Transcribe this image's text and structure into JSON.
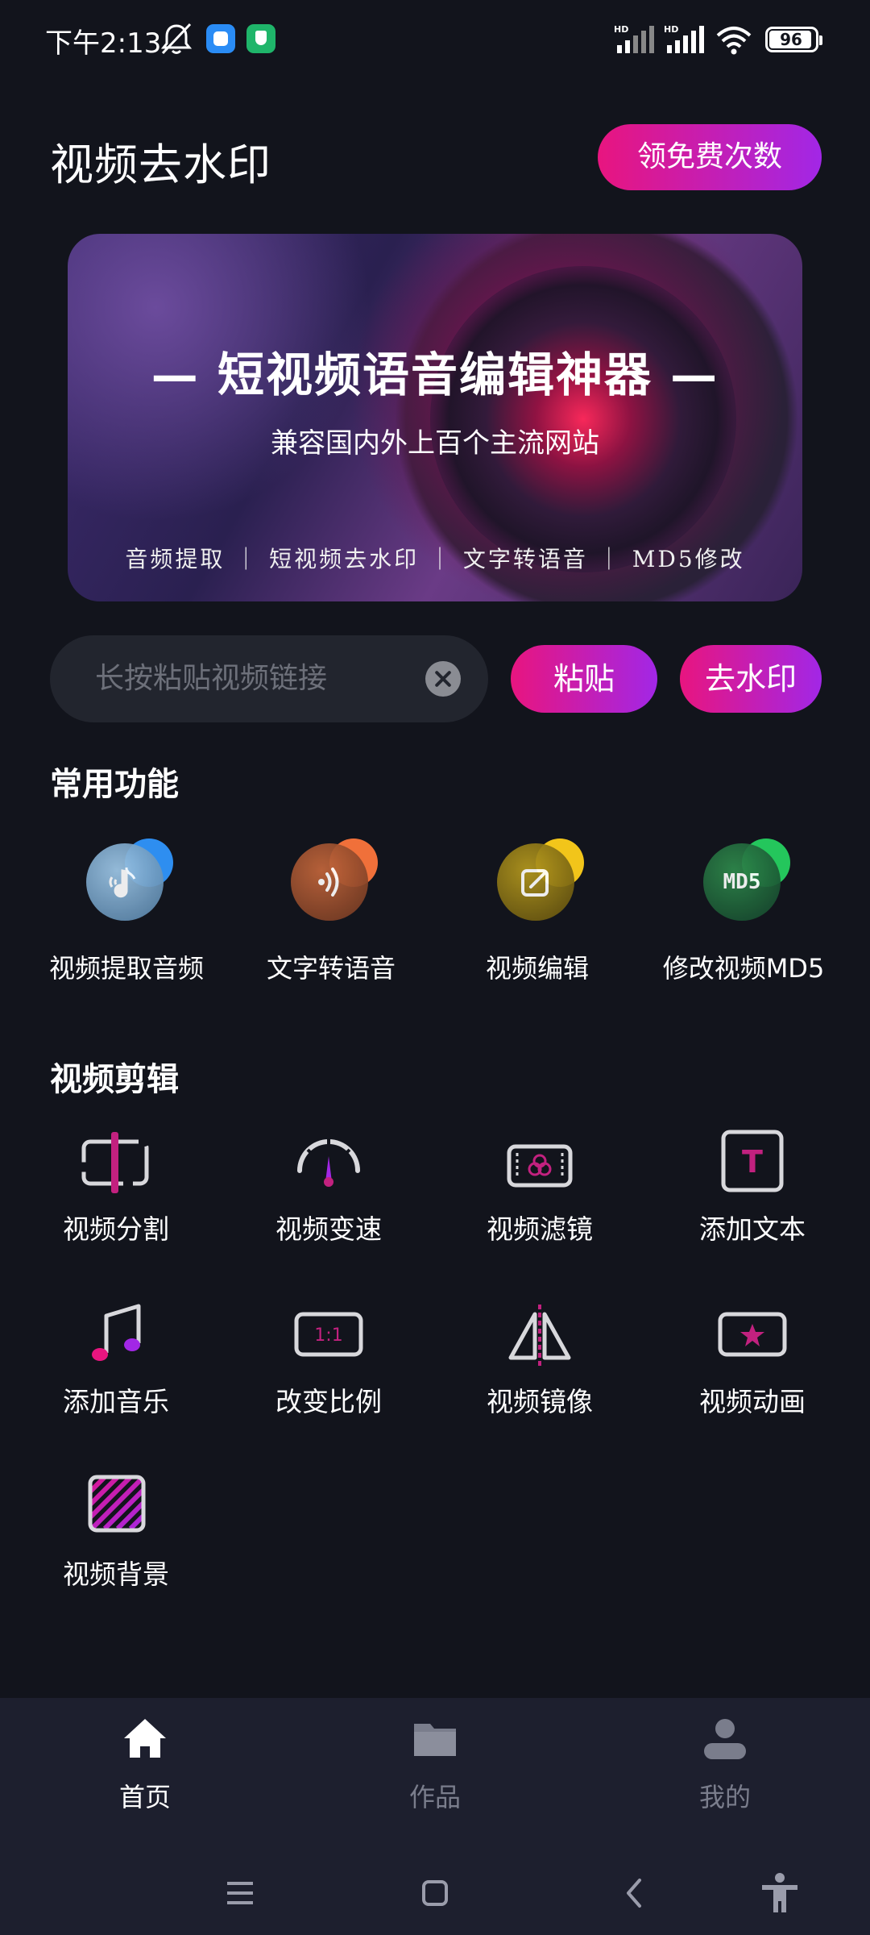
{
  "status_bar": {
    "time": "下午2:13",
    "battery": "96",
    "icons": [
      "bell-muted-icon",
      "app-icon-blue",
      "app-icon-green-shield",
      "hd-signal-icon",
      "hd-signal-icon",
      "wifi-icon",
      "battery-icon"
    ]
  },
  "header": {
    "title": "视频去水印",
    "free_button": "领免费次数"
  },
  "banner": {
    "title": "— 短视频语音编辑神器 —",
    "subtitle": "兼容国内外上百个主流网站",
    "tags": "音频提取 ｜ 短视频去水印 ｜ 文字转语音 ｜ MD5修改"
  },
  "link_input": {
    "placeholder": "长按粘贴视频链接"
  },
  "buttons": {
    "paste": "粘贴",
    "remove_watermark": "去水印"
  },
  "common": {
    "title": "常用功能",
    "items": [
      {
        "label": "视频提取音频",
        "icon": "music-note-icon",
        "color": "#2e8ef0"
      },
      {
        "label": "文字转语音",
        "icon": "sound-wave-icon",
        "color": "#f0703a"
      },
      {
        "label": "视频编辑",
        "icon": "edit-icon",
        "color": "#f2c51a"
      },
      {
        "label": "修改视频MD5",
        "icon": "md5-icon",
        "md5_text": "MD5",
        "color": "#24c65c"
      }
    ]
  },
  "video_edit": {
    "title": "视频剪辑",
    "items": [
      {
        "label": "视频分割",
        "icon": "split-icon"
      },
      {
        "label": "视频变速",
        "icon": "speedometer-icon"
      },
      {
        "label": "视频滤镜",
        "icon": "filter-icon"
      },
      {
        "label": "添加文本",
        "icon": "text-icon",
        "glyph": "T"
      },
      {
        "label": "添加音乐",
        "icon": "music-icon"
      },
      {
        "label": "改变比例",
        "icon": "ratio-icon",
        "glyph": "1:1"
      },
      {
        "label": "视频镜像",
        "icon": "mirror-icon"
      },
      {
        "label": "视频动画",
        "icon": "star-icon"
      },
      {
        "label": "视频背景",
        "icon": "background-icon"
      }
    ]
  },
  "bottom_nav": {
    "items": [
      {
        "label": "首页",
        "icon": "home-icon",
        "active": true
      },
      {
        "label": "作品",
        "icon": "folder-icon",
        "active": false
      },
      {
        "label": "我的",
        "icon": "user-icon",
        "active": false
      }
    ],
    "active_color": "#ffffff",
    "inactive_color": "#7a7d8c"
  },
  "system_nav": [
    "menu-icon",
    "home-square-icon",
    "back-icon",
    "accessibility-icon"
  ],
  "colors": {
    "background": "#12141c",
    "accent_start": "#e8157f",
    "accent_end": "#a227e6"
  }
}
